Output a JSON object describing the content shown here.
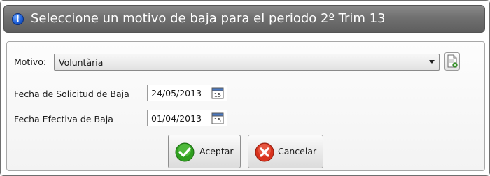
{
  "dialog": {
    "title": "Seleccione un motivo de baja para el periodo 2º Trim 13",
    "title_icon": "info-icon",
    "title_icon_glyph": "!"
  },
  "form": {
    "motivo_label": "Motivo:",
    "motivo_value": "Voluntària",
    "solicitud_label": "Fecha de Solicitud de Baja",
    "solicitud_value": "24/05/2013",
    "efectiva_label": "Fecha Efectiva de Baja",
    "efectiva_value": "01/04/2013",
    "calendar_day": "15"
  },
  "buttons": {
    "accept_label": "Aceptar",
    "cancel_label": "Cancelar"
  },
  "colors": {
    "accept_green": "#2f9e1f",
    "cancel_red": "#d8321d",
    "title_bar": "#6c6c6c"
  }
}
